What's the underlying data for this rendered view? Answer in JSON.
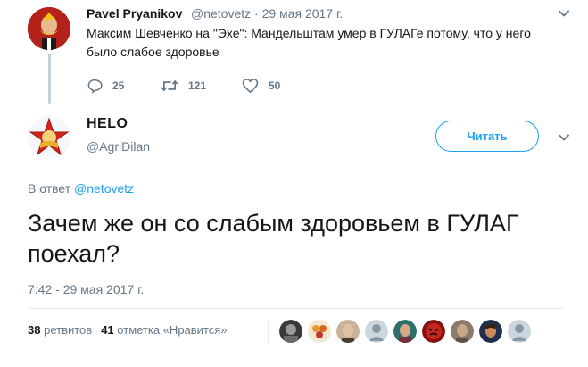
{
  "parent_tweet": {
    "display_name": "Pavel Pryanikov",
    "handle": "@netovetz",
    "separator": "·",
    "date": "29 мая 2017 г.",
    "text": "Максим Шевченко на \"Эхе\": Мандельштам умер в ГУЛАГе потому, что у него было слабое здоровье",
    "actions": {
      "replies": "25",
      "retweets": "121",
      "likes": "50"
    }
  },
  "main_tweet": {
    "display_name": "HELO",
    "handle": "@AgriDilan",
    "follow_label": "Читать",
    "reply_prefix": "В ответ",
    "reply_handle": "@netovetz",
    "text": "Зачем же он со слабым здоровьем в ГУЛАГ поехал?",
    "timestamp": "7:42 - 29 мая 2017 г.",
    "stats": {
      "retweets_count": "38",
      "retweets_label": "ретвитов",
      "likes_count": "41",
      "likes_label": "отметка «Нравится»"
    }
  },
  "icons": {
    "caret": "chevron-down-icon",
    "reply": "reply-icon",
    "retweet": "retweet-icon",
    "like": "heart-icon"
  },
  "colors": {
    "accent": "#1da1f2",
    "muted": "#657786",
    "text": "#14171a",
    "thread_line": "#c4cfd6"
  }
}
